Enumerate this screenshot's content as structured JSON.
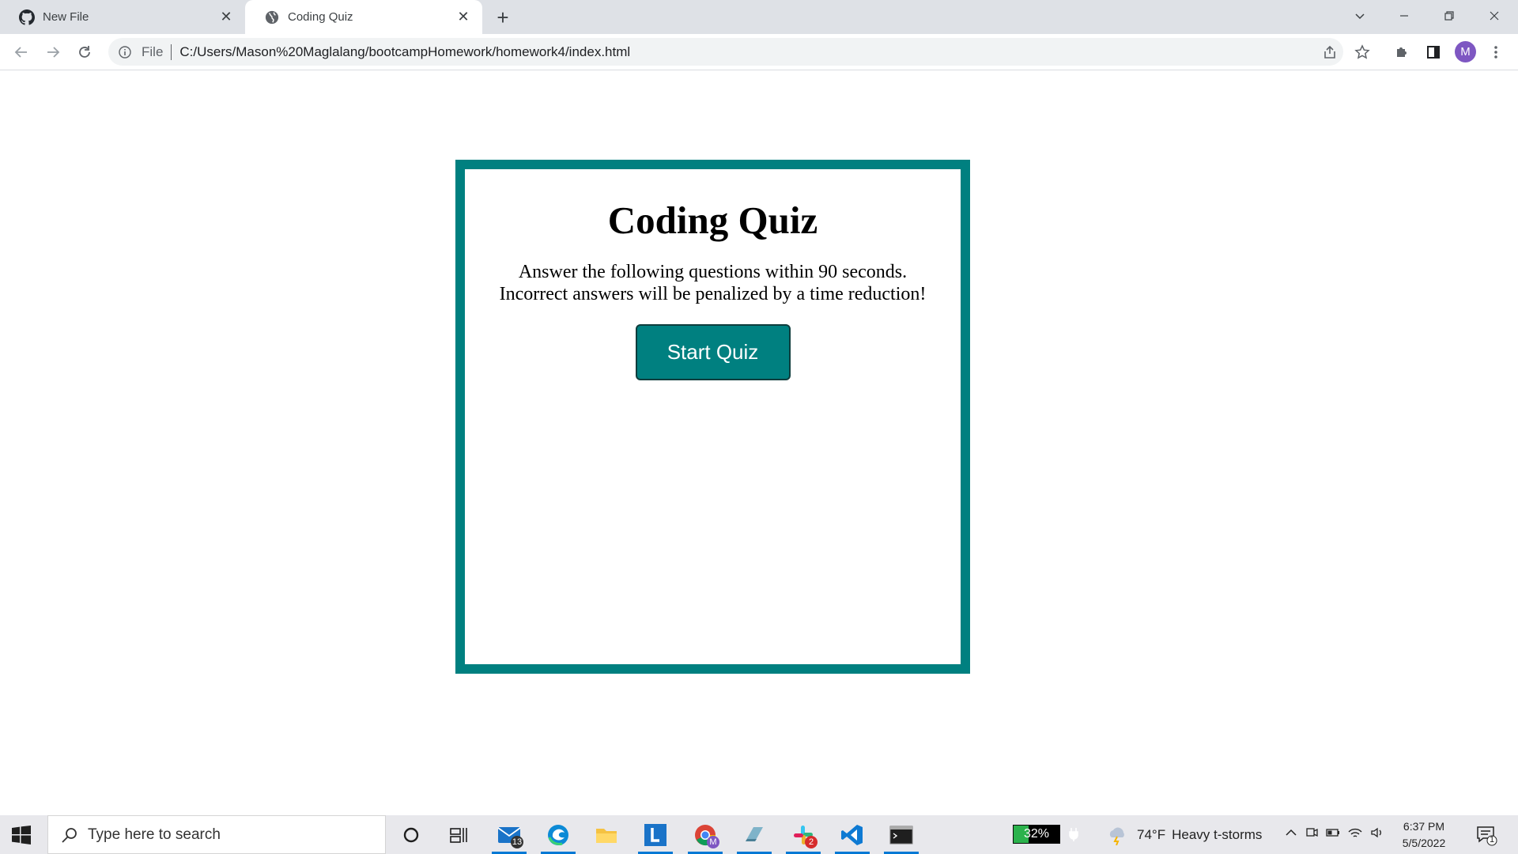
{
  "browser": {
    "tabs": [
      {
        "title": "New File",
        "icon": "github-icon",
        "active": false
      },
      {
        "title": "Coding Quiz",
        "icon": "globe-icon",
        "active": true
      }
    ],
    "omnibox": {
      "scheme_label": "File",
      "url": "C:/Users/Mason%20Maglalang/bootcampHomework/homework4/index.html"
    },
    "profile_initial": "M"
  },
  "page": {
    "title": "Coding Quiz",
    "description_line1": "Answer the following questions within 90 seconds.",
    "description_line2": "Incorrect answers will be penalized by a time reduction!",
    "start_button": "Start Quiz",
    "accent_color": "#008080"
  },
  "taskbar": {
    "search_placeholder": "Type here to search",
    "mail_badge": "13",
    "chrome_profile_badge": "M",
    "slack_badge": "2",
    "battery_percent": "32%",
    "weather_temp": "74°F",
    "weather_desc": "Heavy t-storms",
    "time": "6:37 PM",
    "date": "5/5/2022",
    "notification_count": "1"
  }
}
